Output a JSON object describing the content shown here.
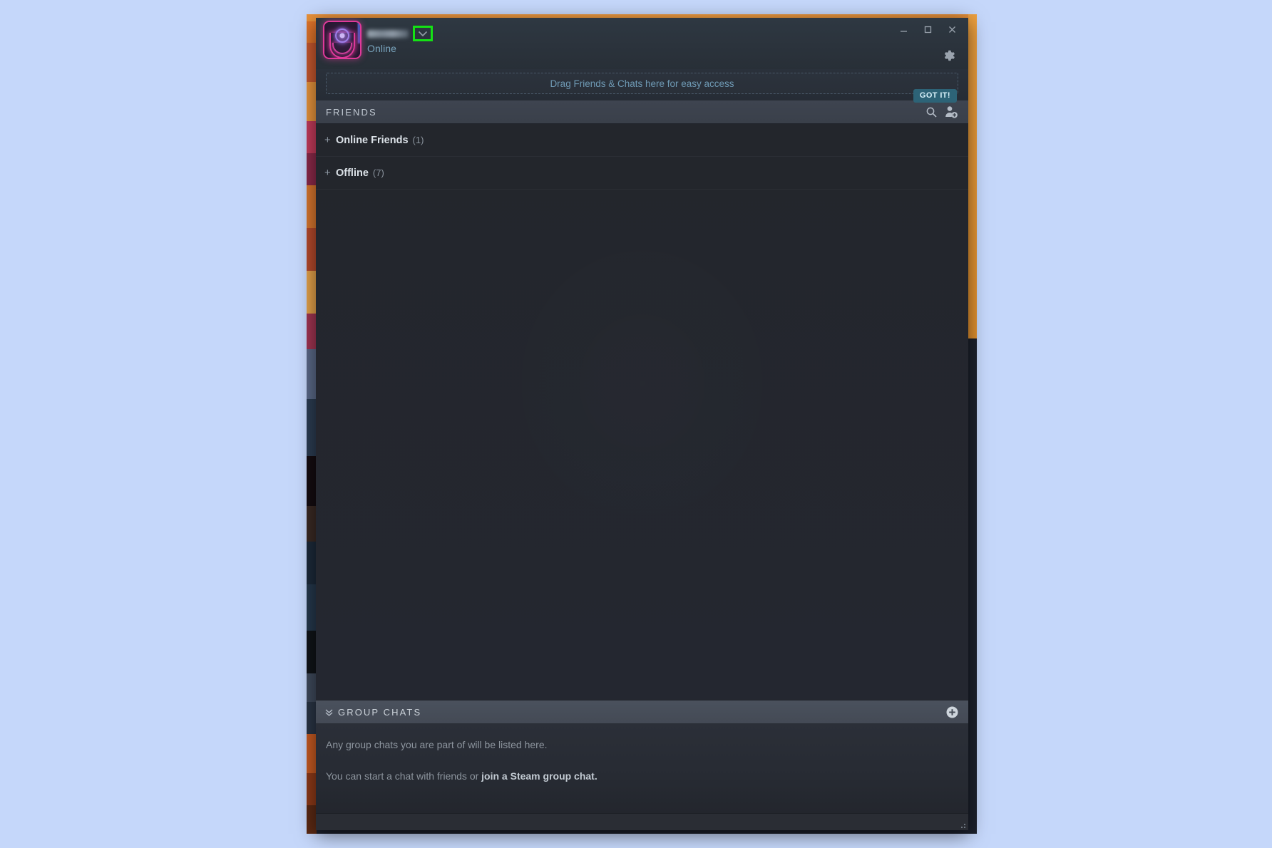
{
  "window": {
    "title_controls": {
      "minimize_label": "—",
      "maximize_label": "□",
      "close_label": "×"
    },
    "settings_icon": "gear-icon"
  },
  "user": {
    "name": "",
    "name_redacted": true,
    "status": "Online",
    "dropdown_icon": "chevron-down-icon",
    "avatar_icon": "neon-avatar",
    "highlight_color": "#14e214"
  },
  "drag_hint": {
    "text": "Drag Friends & Chats here for easy access",
    "dismiss_label": "GOT IT!"
  },
  "friends_header": {
    "title": "FRIENDS",
    "search_icon": "search-icon",
    "add_friend_icon": "add-friend-icon"
  },
  "friends_groups": [
    {
      "expander": "+",
      "label": "Online Friends",
      "count": "(1)"
    },
    {
      "expander": "+",
      "label": "Offline",
      "count": "(7)"
    }
  ],
  "group_chats": {
    "collapse_icon": "chevron-double-down-icon",
    "title": "GROUP CHATS",
    "add_icon": "plus-circle-icon",
    "empty_line1": "Any group chats you are part of will be listed here.",
    "empty_line2_prefix": "You can start a chat with friends or ",
    "empty_line2_link": "join a Steam group chat.",
    "empty_line2_suffix": ""
  },
  "theme": {
    "window_bg": "#23252b",
    "titlebar_bg": "#2b333c",
    "header_bar_bg": "#3a404a",
    "group_chats_bar_bg": "#444a55",
    "accent_link": "#6f9ab5",
    "got_it_bg": "#2d6377",
    "desktop_bg": "#c5d7fa",
    "background_window_orange": "#e8913a"
  }
}
